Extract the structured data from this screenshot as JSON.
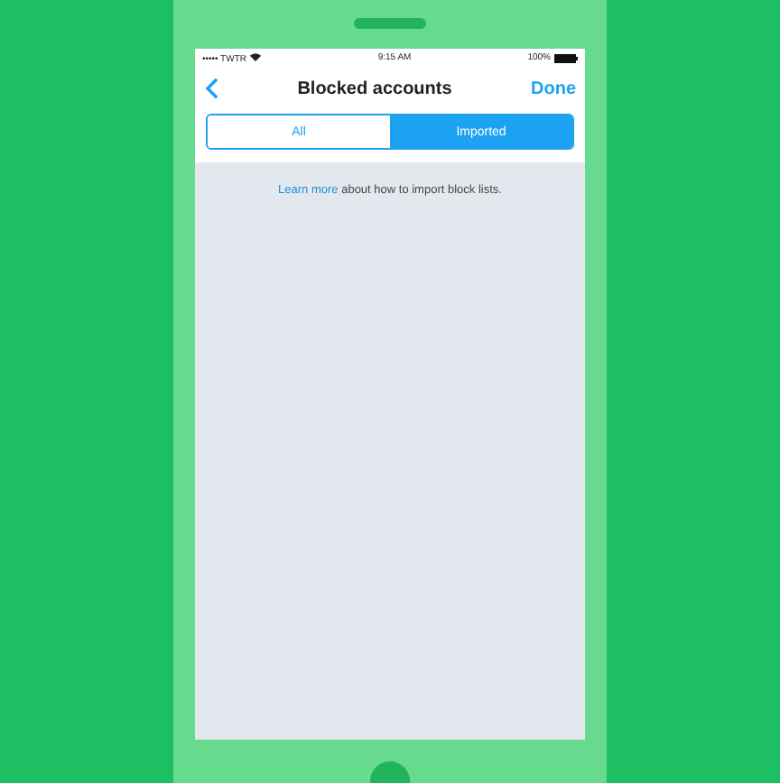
{
  "status_bar": {
    "carrier": "••••• TWTR",
    "time": "9:15 AM",
    "battery": "100%"
  },
  "nav": {
    "title": "Blocked accounts",
    "action": "Done"
  },
  "segments": [
    {
      "label": "All",
      "selected": false
    },
    {
      "label": "Imported",
      "selected": true
    }
  ],
  "info": {
    "link": "Learn more",
    "text": "about how to import block lists."
  }
}
